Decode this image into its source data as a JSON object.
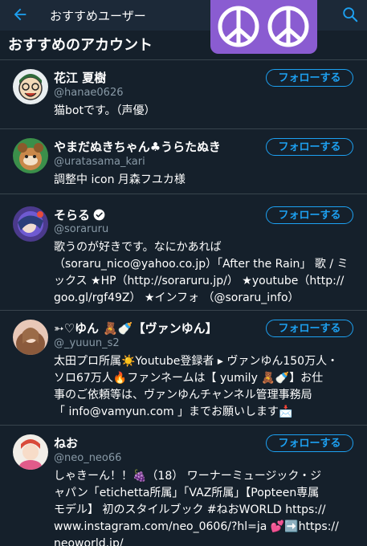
{
  "header": {
    "title": "おすすめユーザー",
    "back_icon": "arrow-left-icon",
    "search_icon": "search-icon",
    "peace_icons": [
      "peace-icon",
      "peace-icon"
    ],
    "accent": "#1da1f2",
    "peace_bg": "#8a5cd1"
  },
  "section": {
    "title": "おすすめのアカウント"
  },
  "users": [
    {
      "name": "花江 夏樹",
      "handle": "@hanae0626",
      "bio": "猫botです。（声優）",
      "follow_label": "フォローする",
      "verified": false
    },
    {
      "name": "やまだぬきちゃん♣うらたぬき",
      "handle": "@uratasama_kari",
      "bio": "調整中 icon 月森フユカ様",
      "follow_label": "フォローする",
      "verified": false
    },
    {
      "name": "そらる",
      "handle": "@soraruru",
      "bio": "歌うのが好きです。なにかあれば\n（soraru_nico@yahoo.co.jp）「After the Rain」 歌 / ミ\nックス ★HP（http://soraruru.jp/） ★youtube（http://\ngoo.gl/rgf49Z） ★インフォ （@soraru_info）",
      "follow_label": "フォローする",
      "verified": true
    },
    {
      "name": "➳♡ゆん 🧸🍼【ヴァンゆん】",
      "handle": "@_yuuun_s2",
      "bio": "太田プロ所属☀️Youtube登録者 ▸ ヴァンゆん150万人・\nソロ67万人🔥ファンネームは【 yumily 🧸🍼】お仕\n事のご依頼等は、ヴァンゆんチャンネル管理事務局\n「 info@vamyun.com 」までお願いします📩",
      "follow_label": "フォローする",
      "verified": false
    },
    {
      "name": "ねお",
      "handle": "@neo_neo66",
      "bio": "しゃきーん！！🍇（18） ワーナーミュージック・ジ\nャパン「etichetta所属」「VAZ所属」【Popteen専属\nモデル】 初のスタイルブック #ねおWORLD https://\nwww.instagram.com/neo_0606/?hl=ja 💕➡️https://\nneoworld.jp/",
      "follow_label": "フォローする",
      "verified": false
    }
  ]
}
